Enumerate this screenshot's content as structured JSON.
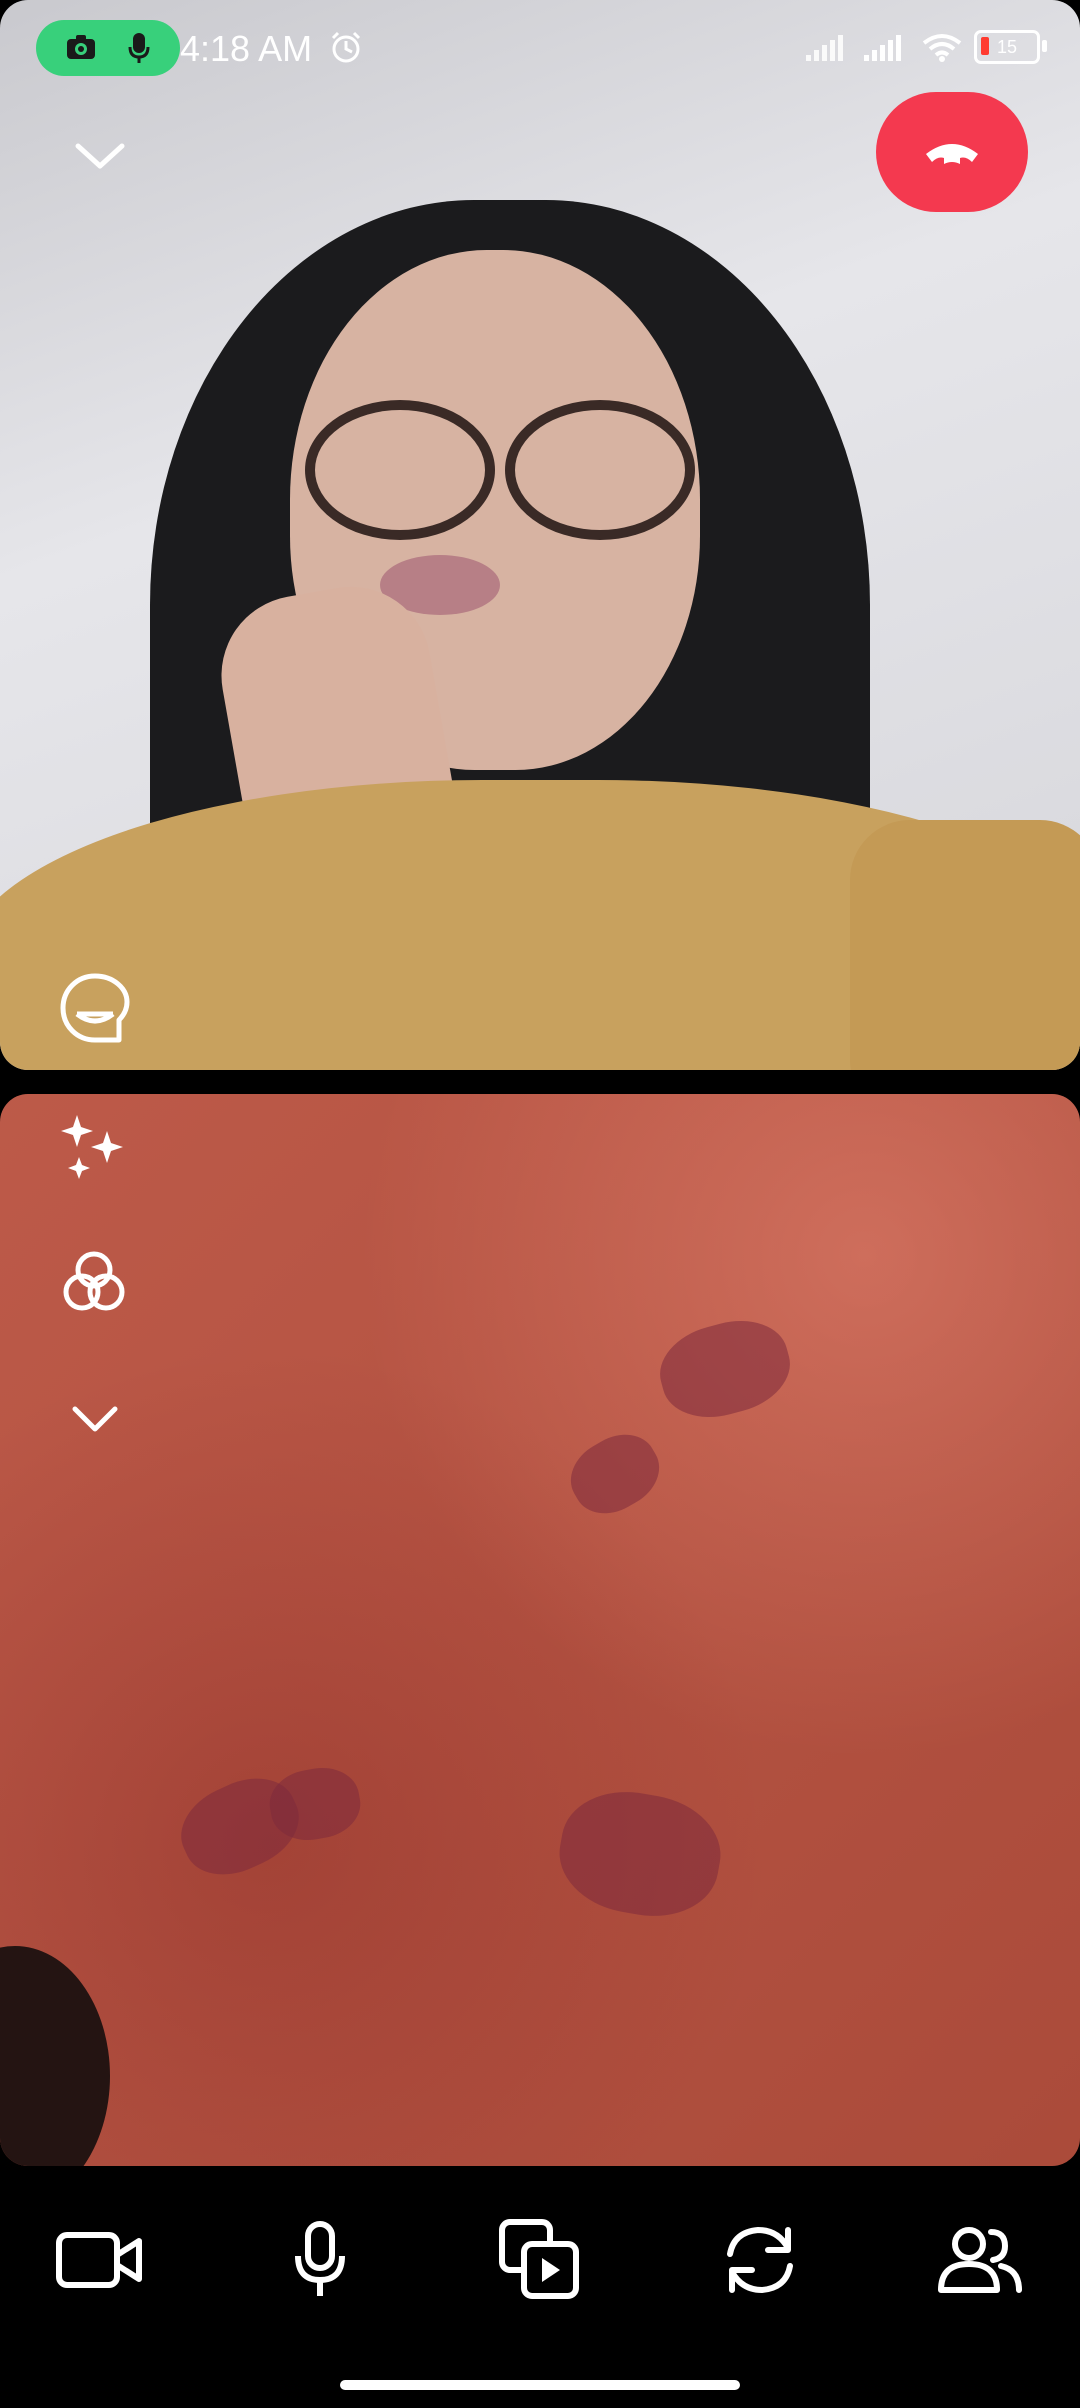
{
  "status_bar": {
    "time": "4:18 AM",
    "battery_level": "15",
    "icons": [
      "camera-icon",
      "microphone-icon",
      "alarm-icon",
      "signal-icon",
      "signal-icon",
      "wifi-icon",
      "battery-icon"
    ],
    "privacy_pill_color": "#38d07b"
  },
  "call_controls": {
    "end_call_color": "#f4394f",
    "top_left_icon": "chevron-down-icon",
    "remote_overlay_icon": "expression-icon",
    "self_overlay_icons": [
      "sparkles-icon",
      "filters-icon",
      "chevron-down-icon"
    ]
  },
  "bottom_bar": {
    "items": [
      "video-camera-icon",
      "microphone-icon",
      "media-share-icon",
      "flip-camera-icon",
      "participants-icon"
    ]
  },
  "colors": {
    "background": "#000000",
    "icon": "#ffffff"
  }
}
